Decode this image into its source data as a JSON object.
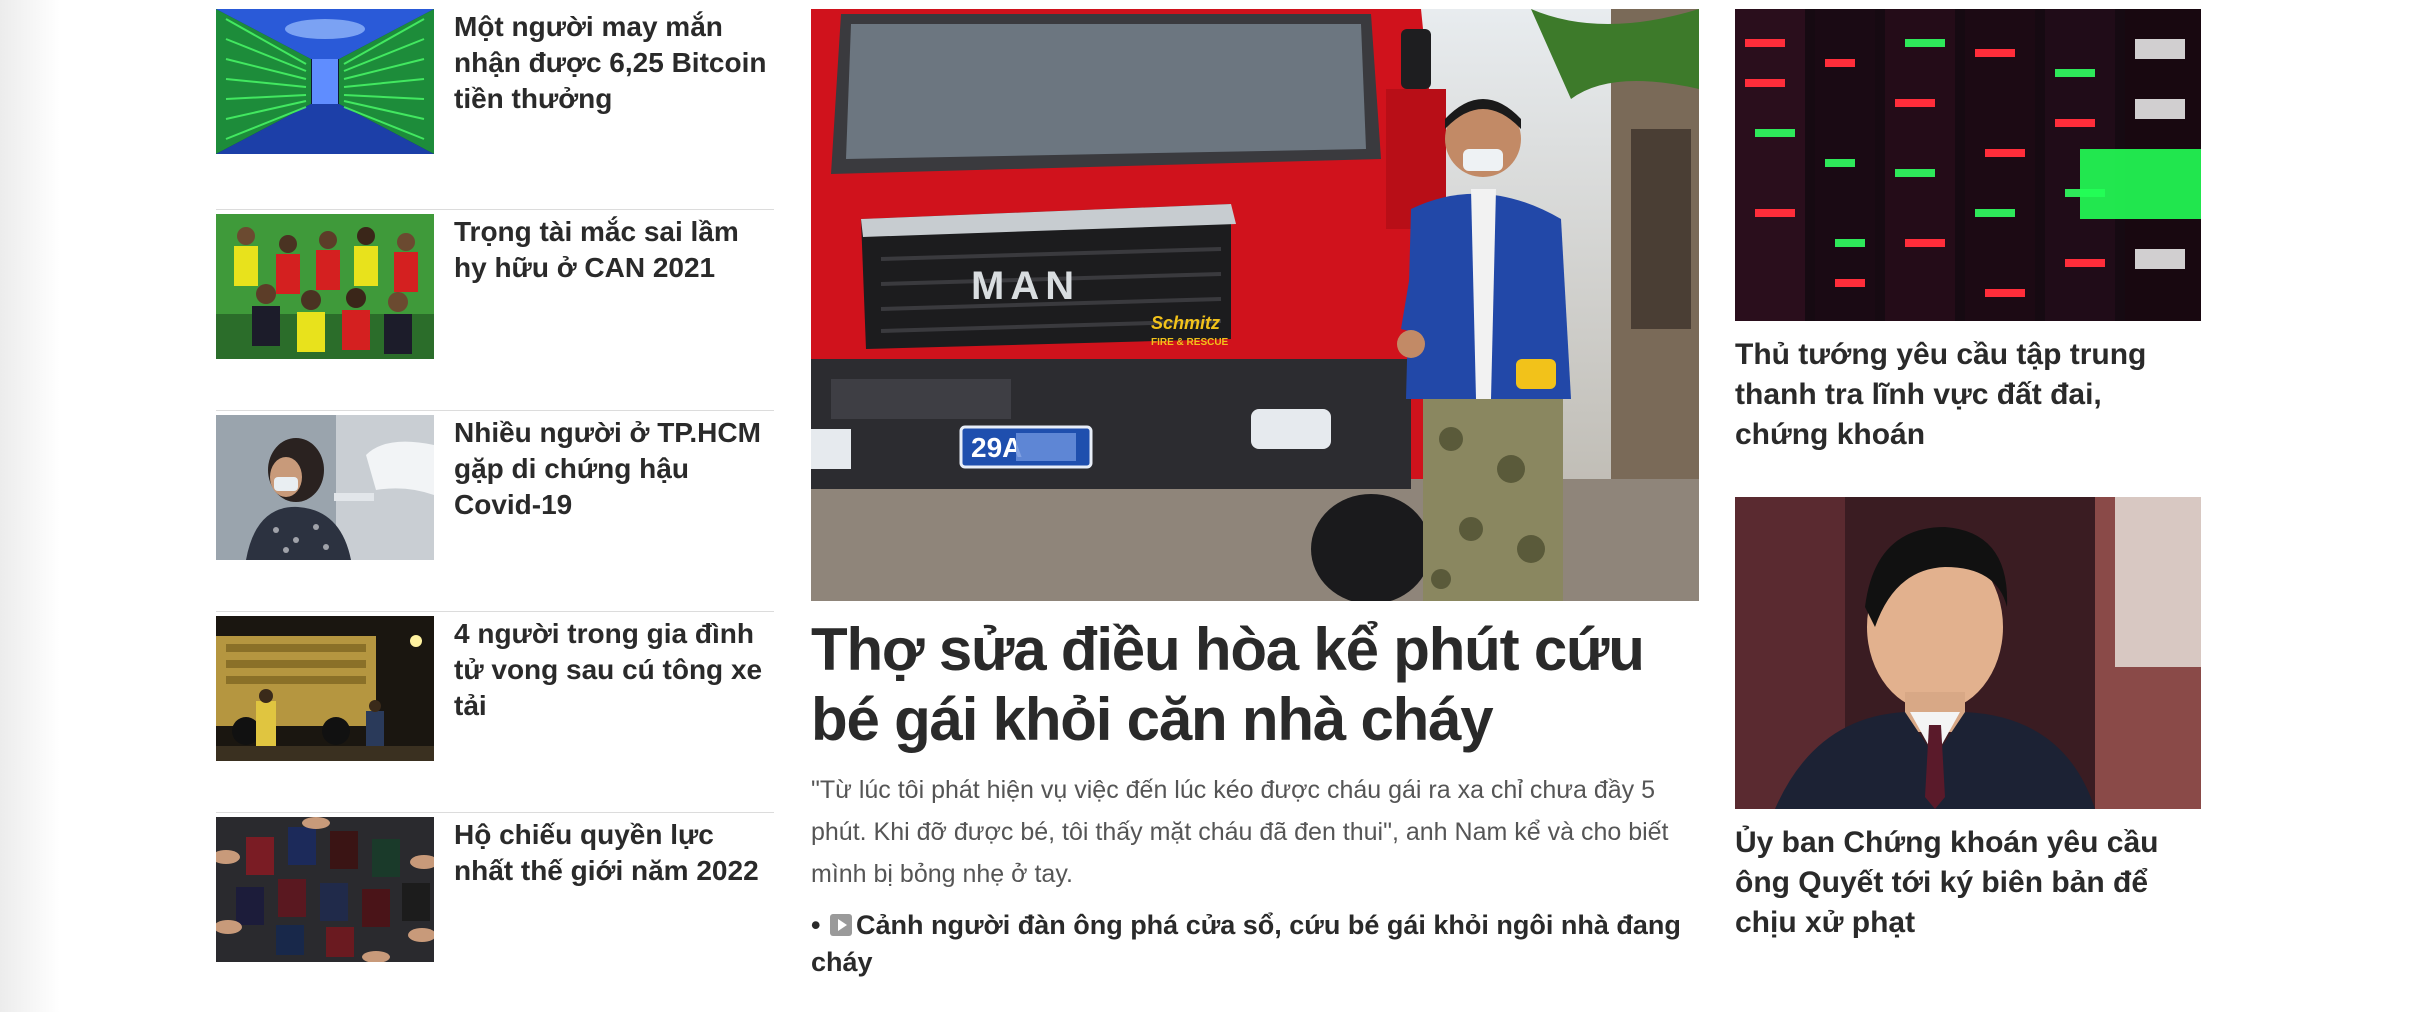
{
  "left_column": {
    "items": [
      {
        "title": "Một người may mắn nhận được 6,25 Bitcoin tiền thưởng",
        "thumb": "bitcoin-mining-farm-image"
      },
      {
        "title": "Trọng tài mắc sai lầm hy hữu ở CAN 2021",
        "thumb": "referees-team-photo"
      },
      {
        "title": "Nhiều người ở TP.HCM gặp di chứng hậu Covid-19",
        "thumb": "covid-patient-image"
      },
      {
        "title": "4 người trong gia đình tử vong sau cú tông xe tải",
        "thumb": "night-truck-accident-image"
      },
      {
        "title": "Hộ chiếu quyền lực nhất thế giới năm 2022",
        "thumb": "passports-circle-image"
      }
    ]
  },
  "center": {
    "hero_image": "fire-truck-man-thumbs-up-photo",
    "hero_truck_brand": "MAN",
    "hero_truck_badge": "Schmitz",
    "hero_truck_badge_sub": "FIRE & RESCUE",
    "hero_plate": "29A",
    "headline": "Thợ sửa điều hòa kể phút cứu bé gái khỏi căn nhà cháy",
    "summary": "\"Từ lúc tôi phát hiện vụ việc đến lúc kéo được cháu gái ra xa chỉ chưa đầy 5 phút. Khi đỡ được bé, tôi thấy mặt cháu đã đen thui\", anh Nam kể và cho biết mình bị bỏng nhẹ ở tay.",
    "related_bullet": "•",
    "related_icon": "video-play-icon",
    "related_title": "Cảnh người đàn ông phá cửa sổ, cứu bé gái khỏi ngôi nhà đang cháy"
  },
  "right_column": {
    "items": [
      {
        "title": "Thủ tướng yêu cầu tập trung thanh tra lĩnh vực đất đai, chứng khoán",
        "thumb": "stock-board-image"
      },
      {
        "title": "Ủy ban Chứng khoán yêu cầu ông Quyết tới ký biên bản để chịu xử phạt",
        "thumb": "businessman-portrait-image"
      }
    ]
  },
  "colors": {
    "title_text": "#2a2a2a",
    "summary_text": "#555555",
    "divider": "#dcdcdc",
    "truck_red": "#d0121c"
  }
}
